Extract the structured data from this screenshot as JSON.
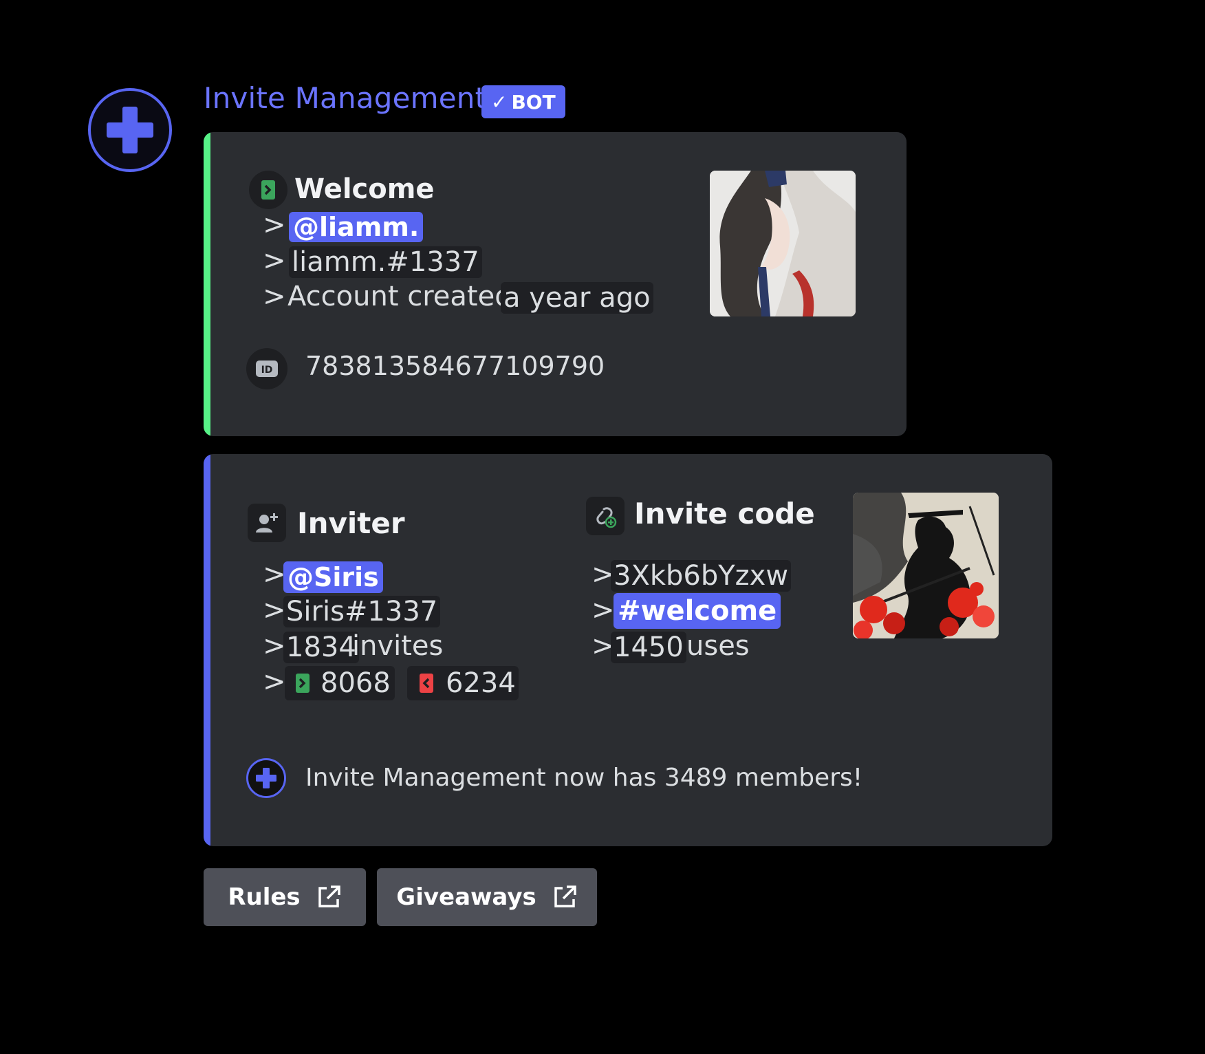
{
  "bot": {
    "name": "Invite Management",
    "tag": "BOT",
    "accent": "#5865f2"
  },
  "welcome_embed": {
    "bar_color": "#57f287",
    "title": "Welcome",
    "prefix": ">",
    "mention": "@liamm.",
    "tag": "liamm.#1337",
    "account_created_label": "Account created",
    "account_created_value": "a year ago",
    "user_id": "783813584677109790",
    "icons": [
      "join-icon",
      "id-icon"
    ]
  },
  "invite_embed": {
    "bar_color": "#5865f2",
    "inviter": {
      "title": "Inviter",
      "mention": "@Siris",
      "tag": "Siris#1337",
      "invites_count": "1834",
      "invites_label": "invites",
      "joins": "8068",
      "leaves": "6234"
    },
    "invite_code": {
      "title": "Invite code",
      "code": "3Xkb6bYzxw",
      "channel": "#welcome",
      "uses_count": "1450",
      "uses_label": "uses"
    },
    "footer": "Invite Management now has 3489 members!"
  },
  "buttons": [
    {
      "label": "Rules",
      "icon": "external-link-icon"
    },
    {
      "label": "Giveaways",
      "icon": "external-link-icon"
    }
  ]
}
